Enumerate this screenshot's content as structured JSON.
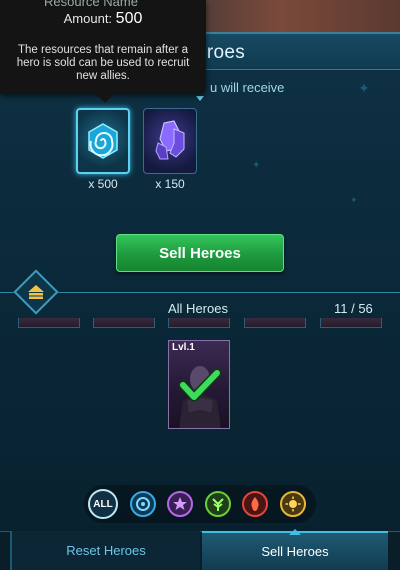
{
  "header": {
    "title": "Heroes",
    "title_visible": "eroes"
  },
  "receive": {
    "text": "u will receive"
  },
  "tooltip": {
    "cut_title": "Resource Name",
    "amount_label": "Amount:",
    "amount_value": "500",
    "description": "The resources that remain after a hero is sold can be used to recruit new allies."
  },
  "resources": [
    {
      "icon": "spiral-crystal-icon",
      "count": "x 500"
    },
    {
      "icon": "purple-crystal-icon",
      "count": "x 150"
    }
  ],
  "sell_button": "Sell Heroes",
  "filter": {
    "label": "All Heroes",
    "counter": "11 / 56"
  },
  "hero": {
    "level": "Lvl.1",
    "selected": true
  },
  "factions": [
    {
      "name": "all",
      "label": "ALL"
    },
    {
      "name": "water-faction-icon"
    },
    {
      "name": "arcane-faction-icon"
    },
    {
      "name": "nature-faction-icon"
    },
    {
      "name": "fire-faction-icon"
    },
    {
      "name": "light-faction-icon"
    }
  ],
  "tabs": {
    "reset": "Reset Heroes",
    "sell": "Sell Heroes"
  },
  "colors": {
    "accent": "#43bfe6",
    "sell_green": "#24a647"
  }
}
